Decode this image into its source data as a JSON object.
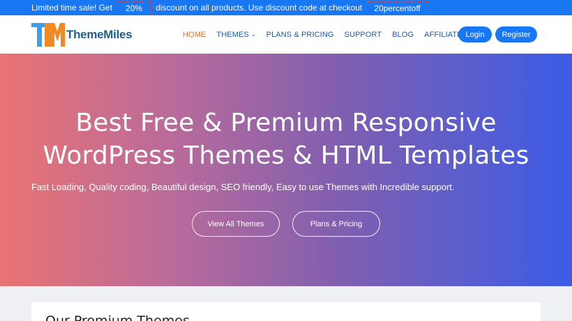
{
  "promo": {
    "text_before": "Limited time sale! Get",
    "percent": "20%",
    "text_middle": "discount on all products. Use discount code at checkout",
    "code": "20percentoff"
  },
  "header": {
    "logo_text": "ThemeMiles",
    "nav": [
      {
        "label": "HOME",
        "active": true
      },
      {
        "label": "THEMES",
        "has_dropdown": true
      },
      {
        "label": "PLANS & PRICING"
      },
      {
        "label": "SUPPORT"
      },
      {
        "label": "BLOG"
      },
      {
        "label": "AFFILIATES"
      }
    ],
    "login_label": "Login",
    "register_label": "Register"
  },
  "hero": {
    "title_line1": "Best Free & Premium Responsive",
    "title_line2": "WordPress Themes & HTML Templates",
    "subtitle": "Fast Loading, Quality coding, Beautiful design, SEO friendly, Easy to use Themes with Incredible support.",
    "view_button": "View All Themes",
    "plans_button": "Plans & Pricing"
  },
  "section": {
    "title": "Our Premium Themes"
  },
  "colors": {
    "brand_blue": "#1877f2",
    "nav_active": "#e8742a",
    "nav_link": "#1f5aa6",
    "gradient_start": "#ea7373",
    "gradient_end": "#3b5ce6"
  }
}
